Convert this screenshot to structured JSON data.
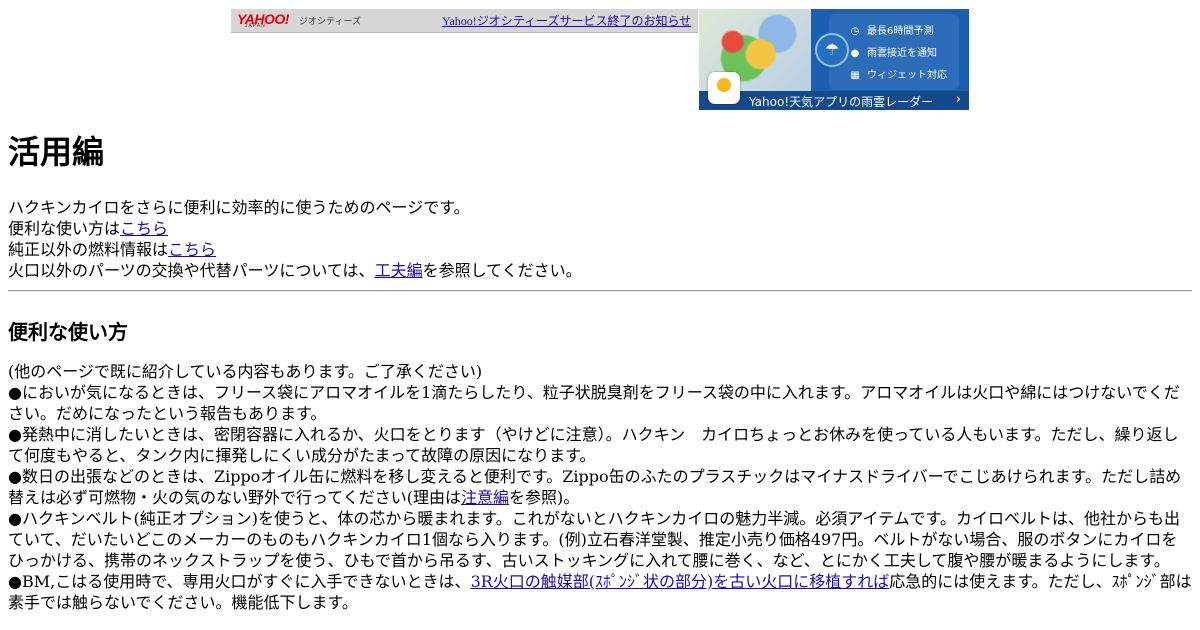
{
  "geocities_bar": {
    "logo": "YAHOO!",
    "logo_sub": "JAPAN",
    "service_name": "ジオシティーズ",
    "notice_link": "Yahoo!ジオシティーズサービス終了のお知らせ"
  },
  "ad": {
    "features": [
      {
        "icon": "clock-icon",
        "glyph": "◷",
        "label": "最長6時間予測"
      },
      {
        "icon": "location-pin-icon",
        "glyph": "●",
        "label": "雨雲接近を通知"
      },
      {
        "icon": "widget-grid-icon",
        "glyph": "▦",
        "label": "ウィジェット対応"
      }
    ],
    "badge_icon": "umbrella-cloud-icon",
    "bottom_text": "Yahoo!天気アプリの雨雲レーダー",
    "chevron": "›"
  },
  "page": {
    "title": "活用編",
    "intro_line1": "ハクキンカイロをさらに便利に効率的に使うためのページです。",
    "intro_line2_prefix": "便利な使い方は",
    "intro_line2_link": "こちら",
    "intro_line3_prefix": "純正以外の燃料情報は",
    "intro_line3_link": "こちら",
    "intro_line4_prefix": "火口以外のパーツの交換や代替パーツについては、",
    "intro_line4_link": "工夫編",
    "intro_line4_suffix": "を参照してください。",
    "section_title": "便利な使い方",
    "note": "(他のページで既に紹介している内容もあります。ご了承ください)",
    "tip1": "●においが気になるときは、フリース袋にアロマオイルを1滴たらしたり、粒子状脱臭剤をフリース袋の中に入れます。アロマオイルは火口や綿にはつけないでください。だめになったという報告もあります。",
    "tip2": "●発熱中に消したいときは、密閉容器に入れるか、火口をとります（やけどに注意）。ハクキン　カイロちょっとお休みを使っている人もいます。ただし、繰り返して何度もやると、タンク内に揮発しにくい成分がたまって故障の原因になります。",
    "tip3_text": "●数日の出張などのときは、Zippoオイル缶に燃料を移し変えると便利です。Zippo缶のふたのプラスチックはマイナスドライバーでこじあけられます。ただし詰め替えは必ず可燃物・火の気のない野外で行ってください(理由は",
    "tip3_link": "注意編",
    "tip3_suffix": "を参照)。",
    "tip4": "●ハクキンベルト(純正オプション)を使うと、体の芯から暖まれます。これがないとハクキンカイロの魅力半減。必須アイテムです。カイロベルトは、他社からも出ていて、だいたいどこのメーカーのものもハクキンカイロ1個なら入ります。(例)立石春洋堂製、推定小売り価格497円。ベルトがない場合、服のボタンにカイロをひっかける、携帯のネックストラップを使う、ひもで首から吊るす、古いストッキングに入れて腰に巻く、など、とにかく工夫して腹や腰が暖まるようにします。",
    "tip5_text": "●BM,こはる使用時で、専用火口がすぐに入手できないときは、",
    "tip5_link": "3R火口の触媒部(ｽﾎﾟﾝｼﾞ状の部分)を古い火口に移植すれば",
    "tip5_suffix": "応急的には使えます。ただし、ｽﾎﾟﾝｼﾞ部は素手では触らないでください。機能低下します。"
  },
  "colors": {
    "link": "#1a0dab",
    "yahoo_red": "#e60012",
    "ad_blue": "#1b5fae"
  }
}
